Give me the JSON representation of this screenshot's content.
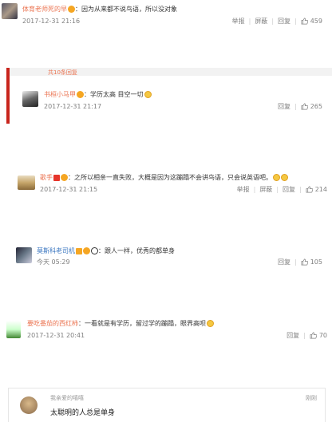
{
  "comments": [
    {
      "name": "体育老师死的早",
      "text": "因为从来都不说鸟语，所以没对象",
      "time": "2017-12-31 21:16",
      "report": "举报",
      "block": "屏蔽",
      "reply": "回复",
      "likes": "459"
    },
    {
      "reply_header": "共10条回复",
      "name": "书桓小马甲",
      "text": "学历太高 目空一切",
      "time": "2017-12-31 21:17",
      "reply": "回复",
      "likes": "265"
    },
    {
      "name": "歌手",
      "text": "之所以相亲一直失败，大概是因为这蹦蹋不会讲鸟语，只会说英语吧。",
      "time": "2017-12-31 21:15",
      "report": "举报",
      "block": "屏蔽",
      "reply": "回复",
      "likes": "214"
    },
    {
      "name": "莫斯科老司机",
      "text": "跟人一样，优秀的都单身",
      "time": "今天 05:29",
      "reply": "回复",
      "likes": "105"
    },
    {
      "name": "要吃番茄的西红柿",
      "text": "一看就是有学历，留过学的蹦蹋，眼界高呗",
      "time": "2017-12-31 20:41",
      "reply": "回复",
      "likes": "70"
    },
    {
      "name": "我亲爱的嘻嘻",
      "text": "太聪明的人总是单身",
      "time_right": "刚刚"
    }
  ],
  "colors": {
    "name": "#eb7350",
    "accent_red": "#c8241c",
    "muted": "#808080"
  }
}
